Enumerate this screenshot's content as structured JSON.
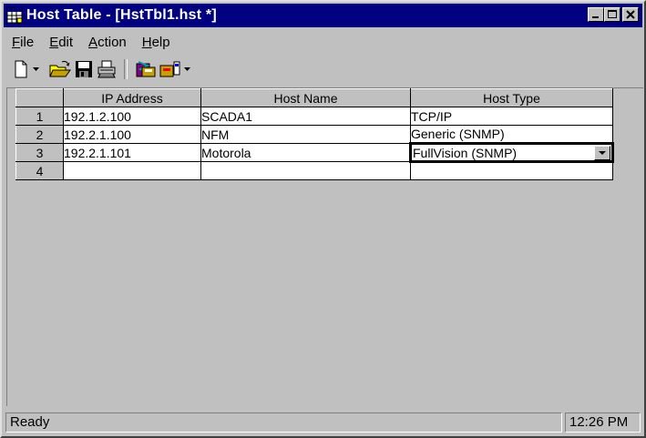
{
  "window": {
    "title": "Host Table - [HstTbl1.hst *]"
  },
  "menu": {
    "items": [
      {
        "accel": "F",
        "rest": "ile"
      },
      {
        "accel": "E",
        "rest": "dit"
      },
      {
        "accel": "A",
        "rest": "ction"
      },
      {
        "accel": "H",
        "rest": "elp"
      }
    ]
  },
  "toolbar": {
    "icons": [
      "new-document-icon",
      "dropdown-arrow-icon",
      "open-folder-icon",
      "save-disk-icon",
      "print-icon",
      "host-import-icon",
      "host-connect-icon",
      "dropdown-arrow-icon"
    ]
  },
  "grid": {
    "headers": [
      "IP Address",
      "Host Name",
      "Host Type"
    ],
    "rows": [
      {
        "num": "1",
        "ip": "192.1.2.100",
        "name": "SCADA1",
        "type": "TCP/IP"
      },
      {
        "num": "2",
        "ip": "192.2.1.100",
        "name": "NFM",
        "type": "Generic (SNMP)"
      },
      {
        "num": "3",
        "ip": "192.2.1.101",
        "name": "Motorola",
        "type": "FullVision (SNMP)"
      },
      {
        "num": "4",
        "ip": "",
        "name": "",
        "type": ""
      }
    ]
  },
  "status": {
    "message": "Ready",
    "time": "12:26 PM"
  },
  "colors": {
    "titlebar": "#000080",
    "face": "#c0c0c0"
  }
}
